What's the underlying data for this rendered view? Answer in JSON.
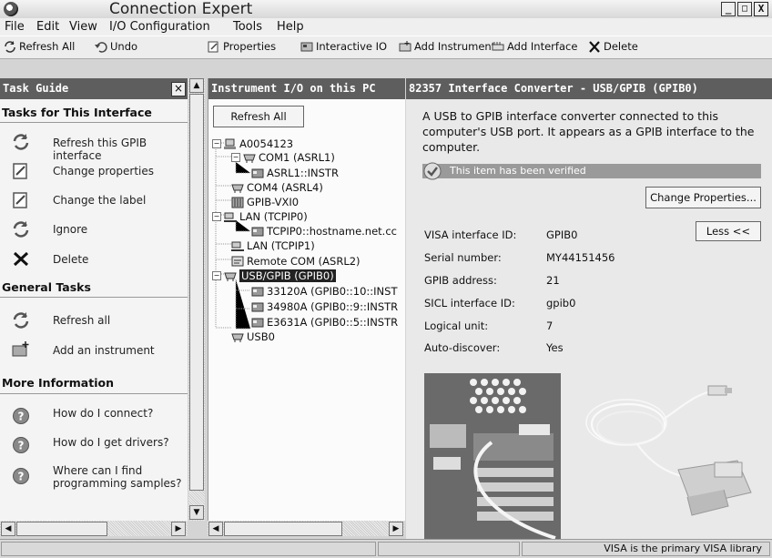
{
  "window": {
    "title": "Connection Expert",
    "minimize": "_",
    "maximize": "□",
    "close": "X"
  },
  "menu": [
    "File",
    "Edit",
    "View",
    "I/O Configuration",
    "Tools",
    "Help"
  ],
  "toolbar": {
    "refresh_all": "Refresh All",
    "undo": "Undo",
    "properties": "Properties",
    "interactive_io": "Interactive IO",
    "add_instrument": "Add Instrument",
    "add_interface": "Add Interface",
    "delete": "Delete"
  },
  "task_guide": {
    "title": "Task Guide",
    "close": "×",
    "section1": "Tasks for This Interface",
    "tasks1": [
      {
        "label": "Refresh this GPIB interface",
        "icon": "refresh-icon"
      },
      {
        "label": "Change properties",
        "icon": "properties-icon"
      },
      {
        "label": "Change the label",
        "icon": "label-icon"
      },
      {
        "label": "Ignore",
        "icon": "ignore-icon"
      },
      {
        "label": "Delete",
        "icon": "delete-icon"
      }
    ],
    "section2": "General Tasks",
    "tasks2": [
      {
        "label": "Refresh all",
        "icon": "refresh-icon"
      },
      {
        "label": "Add an instrument",
        "icon": "add-instrument-icon"
      }
    ],
    "section3": "More Information",
    "info": [
      {
        "label": "How do I connect?",
        "icon": "help-icon"
      },
      {
        "label": "How do I get drivers?",
        "icon": "help-icon"
      },
      {
        "label1": "Where can I find",
        "label2": "programming samples?",
        "icon": "help-icon"
      }
    ]
  },
  "tree": {
    "title": "Instrument I/O on this PC",
    "refresh_all": "Refresh All",
    "nodes": [
      "A0054123",
      "COM1 (ASRL1)",
      "ASRL1::INSTR",
      "COM4 (ASRL4)",
      "GPIB-VXI0",
      "LAN (TCPIP0)",
      "TCPIP0::hostname.net.cc",
      "LAN (TCPIP1)",
      "Remote COM (ASRL2)",
      "USB/GPIB (GPIB0)",
      "33120A (GPIB0::10::INST",
      "34980A (GPIB0::9::INSTR",
      "E3631A (GPIB0::5::INSTR",
      "USB0"
    ]
  },
  "details": {
    "title": "82357 Interface Converter - USB/GPIB (GPIB0)",
    "description_lines": [
      "A USB to GPIB interface converter connected to this",
      "computer's USB port. It appears as a GPIB interface to the",
      "computer."
    ],
    "verified": "This item has been verified",
    "change_properties": "Change Properties...",
    "less": "Less <<",
    "fields": [
      {
        "key": "VISA interface ID:",
        "value": "GPIB0"
      },
      {
        "key": "Serial number:",
        "value": "MY44151456"
      },
      {
        "key": "GPIB address:",
        "value": "21"
      },
      {
        "key": "SICL interface ID:",
        "value": "gpib0"
      },
      {
        "key": "Logical unit:",
        "value": "7"
      },
      {
        "key": "Auto-discover:",
        "value": "Yes"
      }
    ]
  },
  "status": {
    "message": "VISA is the primary VISA library"
  }
}
